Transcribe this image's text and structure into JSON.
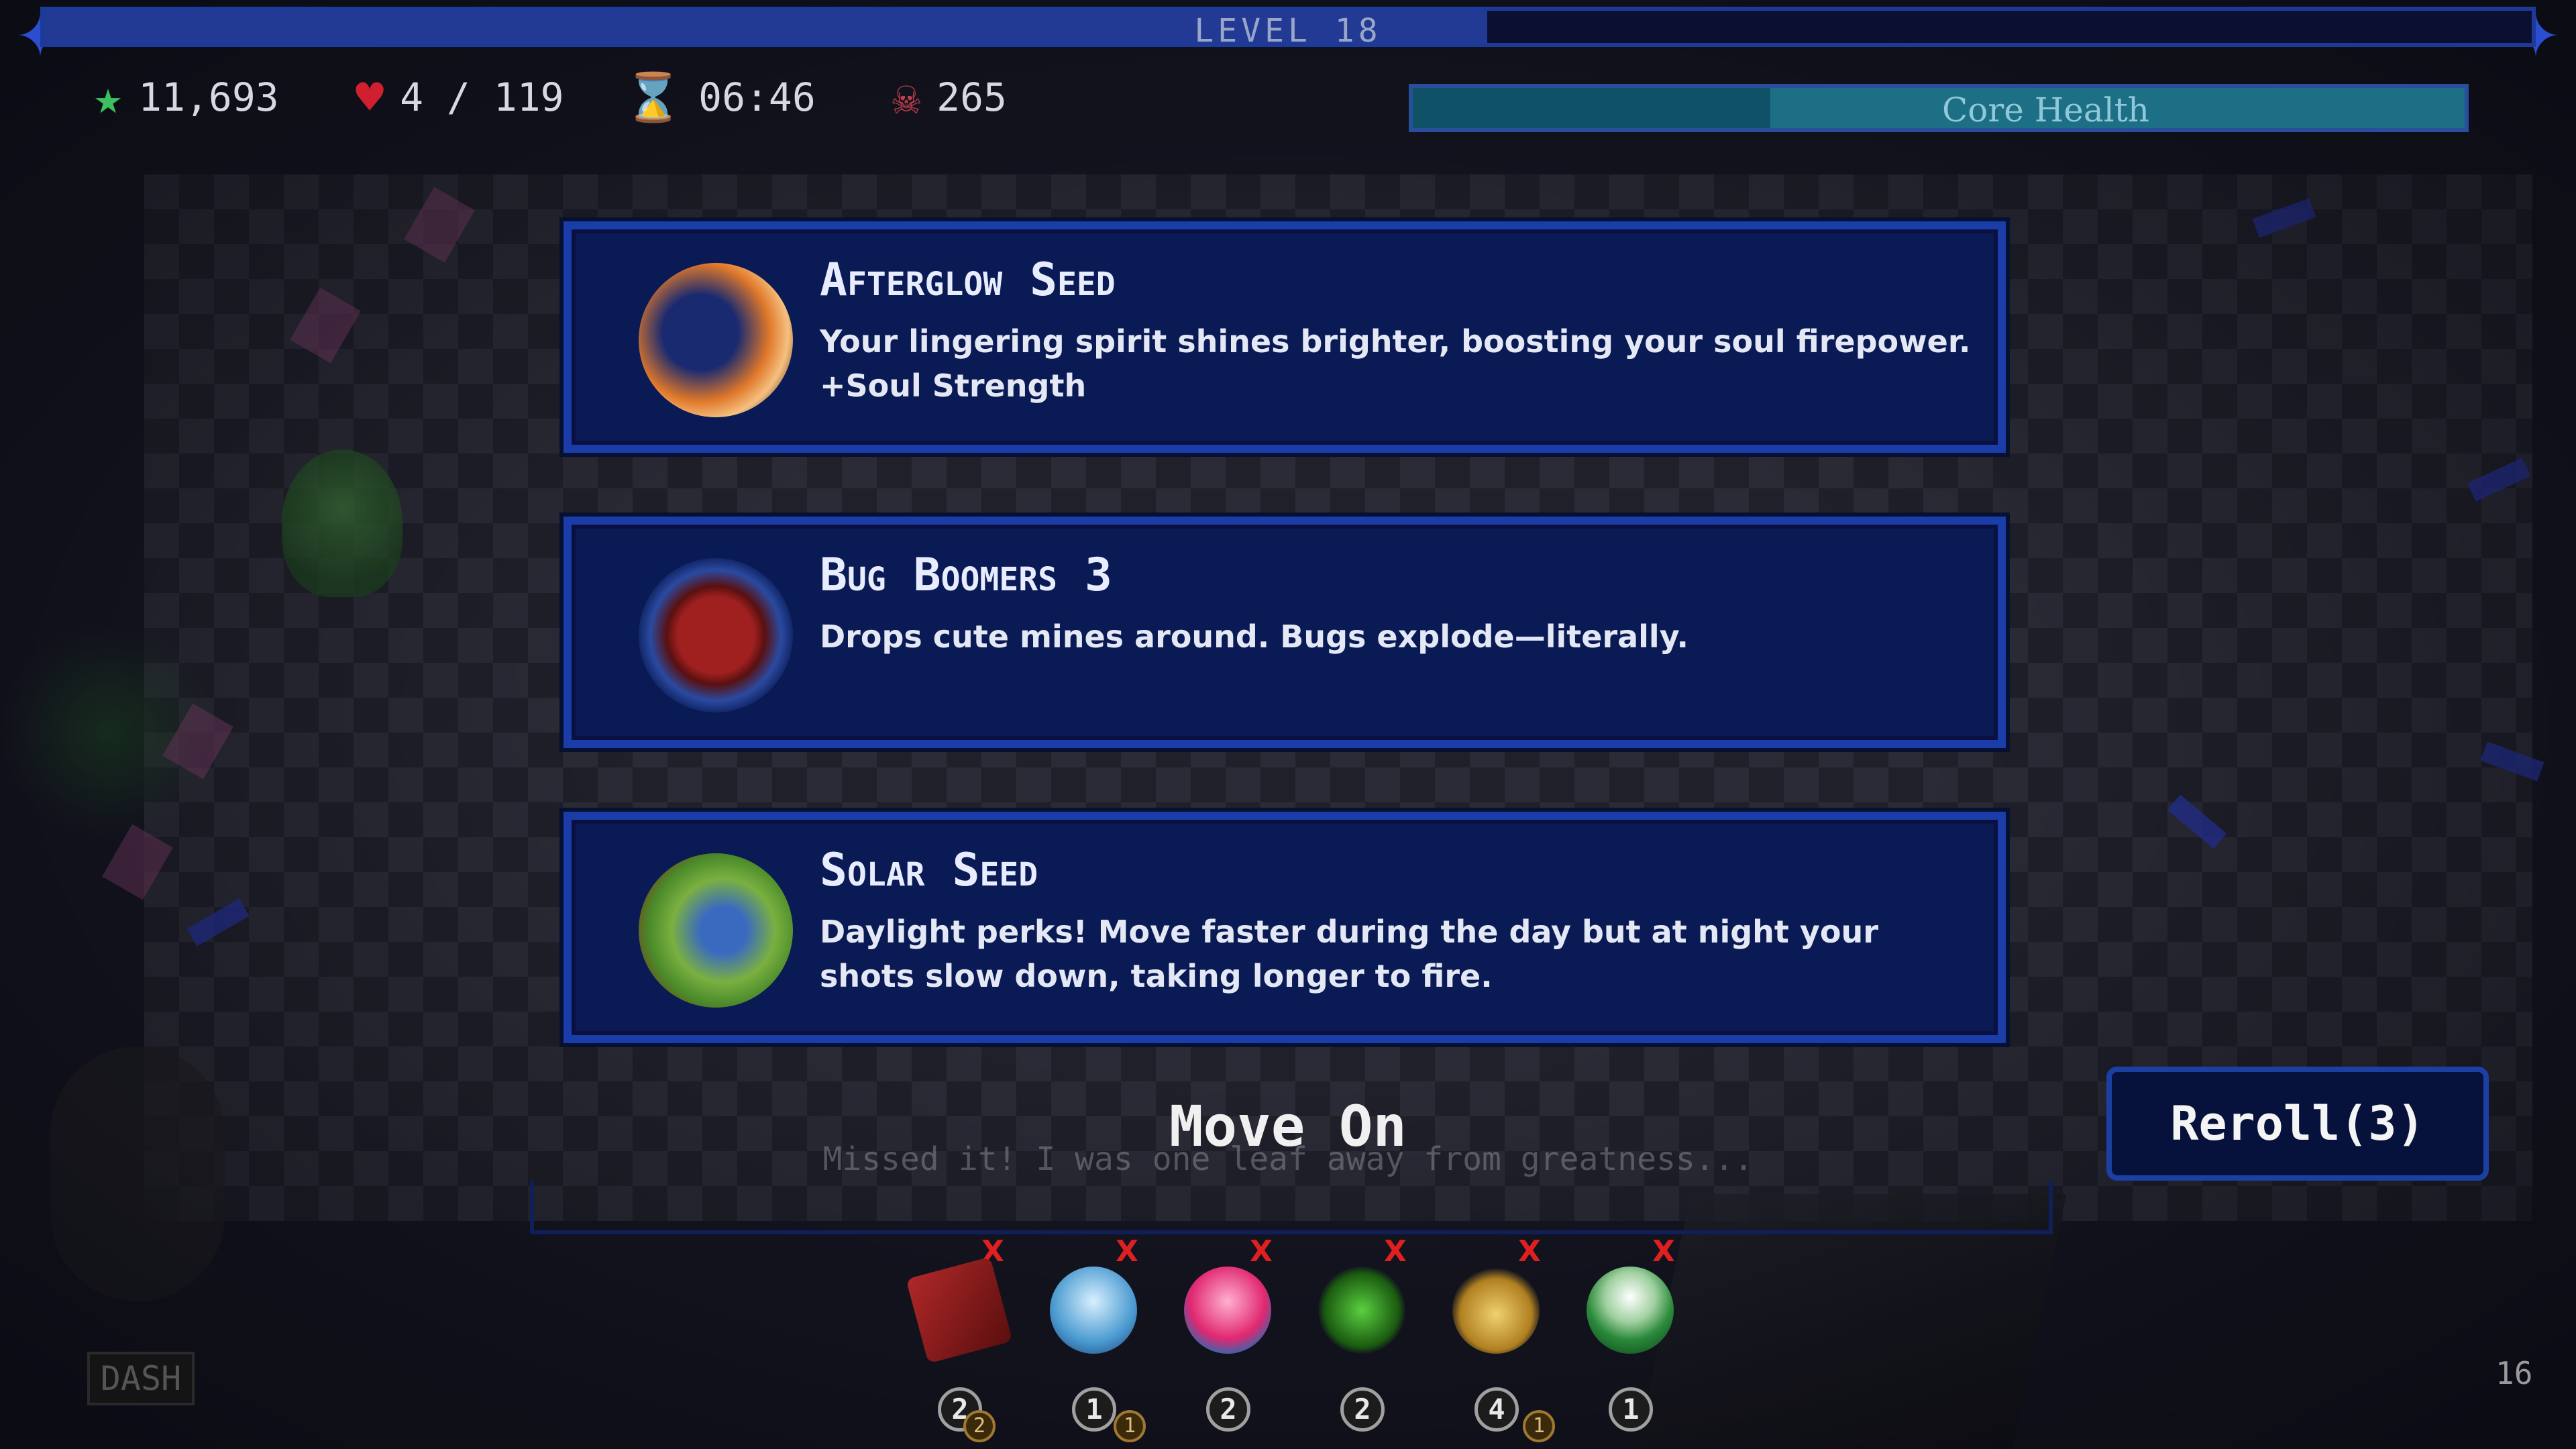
{
  "level": {
    "label": "LEVEL 18",
    "progress": 0.58
  },
  "stats": {
    "score": "11,693",
    "health": "4 / 119",
    "timer": "06:46",
    "kills": "265"
  },
  "core_health": {
    "label": "Core Health",
    "fraction": 0.34
  },
  "choices": [
    {
      "title": "Afterglow Seed",
      "description": "Your lingering spirit shines brighter, boosting your soul firepower. +Soul Strength",
      "icon": "afterglow-seed-icon"
    },
    {
      "title": "Bug Boomers 3",
      "description": "Drops cute mines around. Bugs explode—literally.",
      "icon": "spellbook-icon"
    },
    {
      "title": "Solar Seed",
      "description": "Daylight perks! Move faster during the day but at night your shots slow down, taking longer to fire.",
      "icon": "solar-seed-icon"
    }
  ],
  "move_on": {
    "label": "Move On",
    "quip": "Missed it! I was one leaf away from greatness..."
  },
  "reroll": {
    "label": "Reroll(3)"
  },
  "inventory": [
    {
      "icon": "spellbook-icon",
      "count": "2",
      "sub": "2"
    },
    {
      "icon": "ice-shell-icon",
      "count": "1",
      "sub": "1"
    },
    {
      "icon": "pink-flower-icon",
      "count": "2",
      "sub": ""
    },
    {
      "icon": "green-vine-icon",
      "count": "2",
      "sub": ""
    },
    {
      "icon": "golden-crown-icon",
      "count": "4",
      "sub": "1"
    },
    {
      "icon": "potion-icon",
      "count": "1",
      "sub": ""
    }
  ],
  "inventory_markers": [
    "X",
    "X",
    "X",
    "X",
    "X",
    "X"
  ],
  "dash_label": "DASH",
  "corner_counter": "16",
  "colors": {
    "panel": "#0a1a55",
    "border": "#1b3daa",
    "accent": "#e02020"
  }
}
